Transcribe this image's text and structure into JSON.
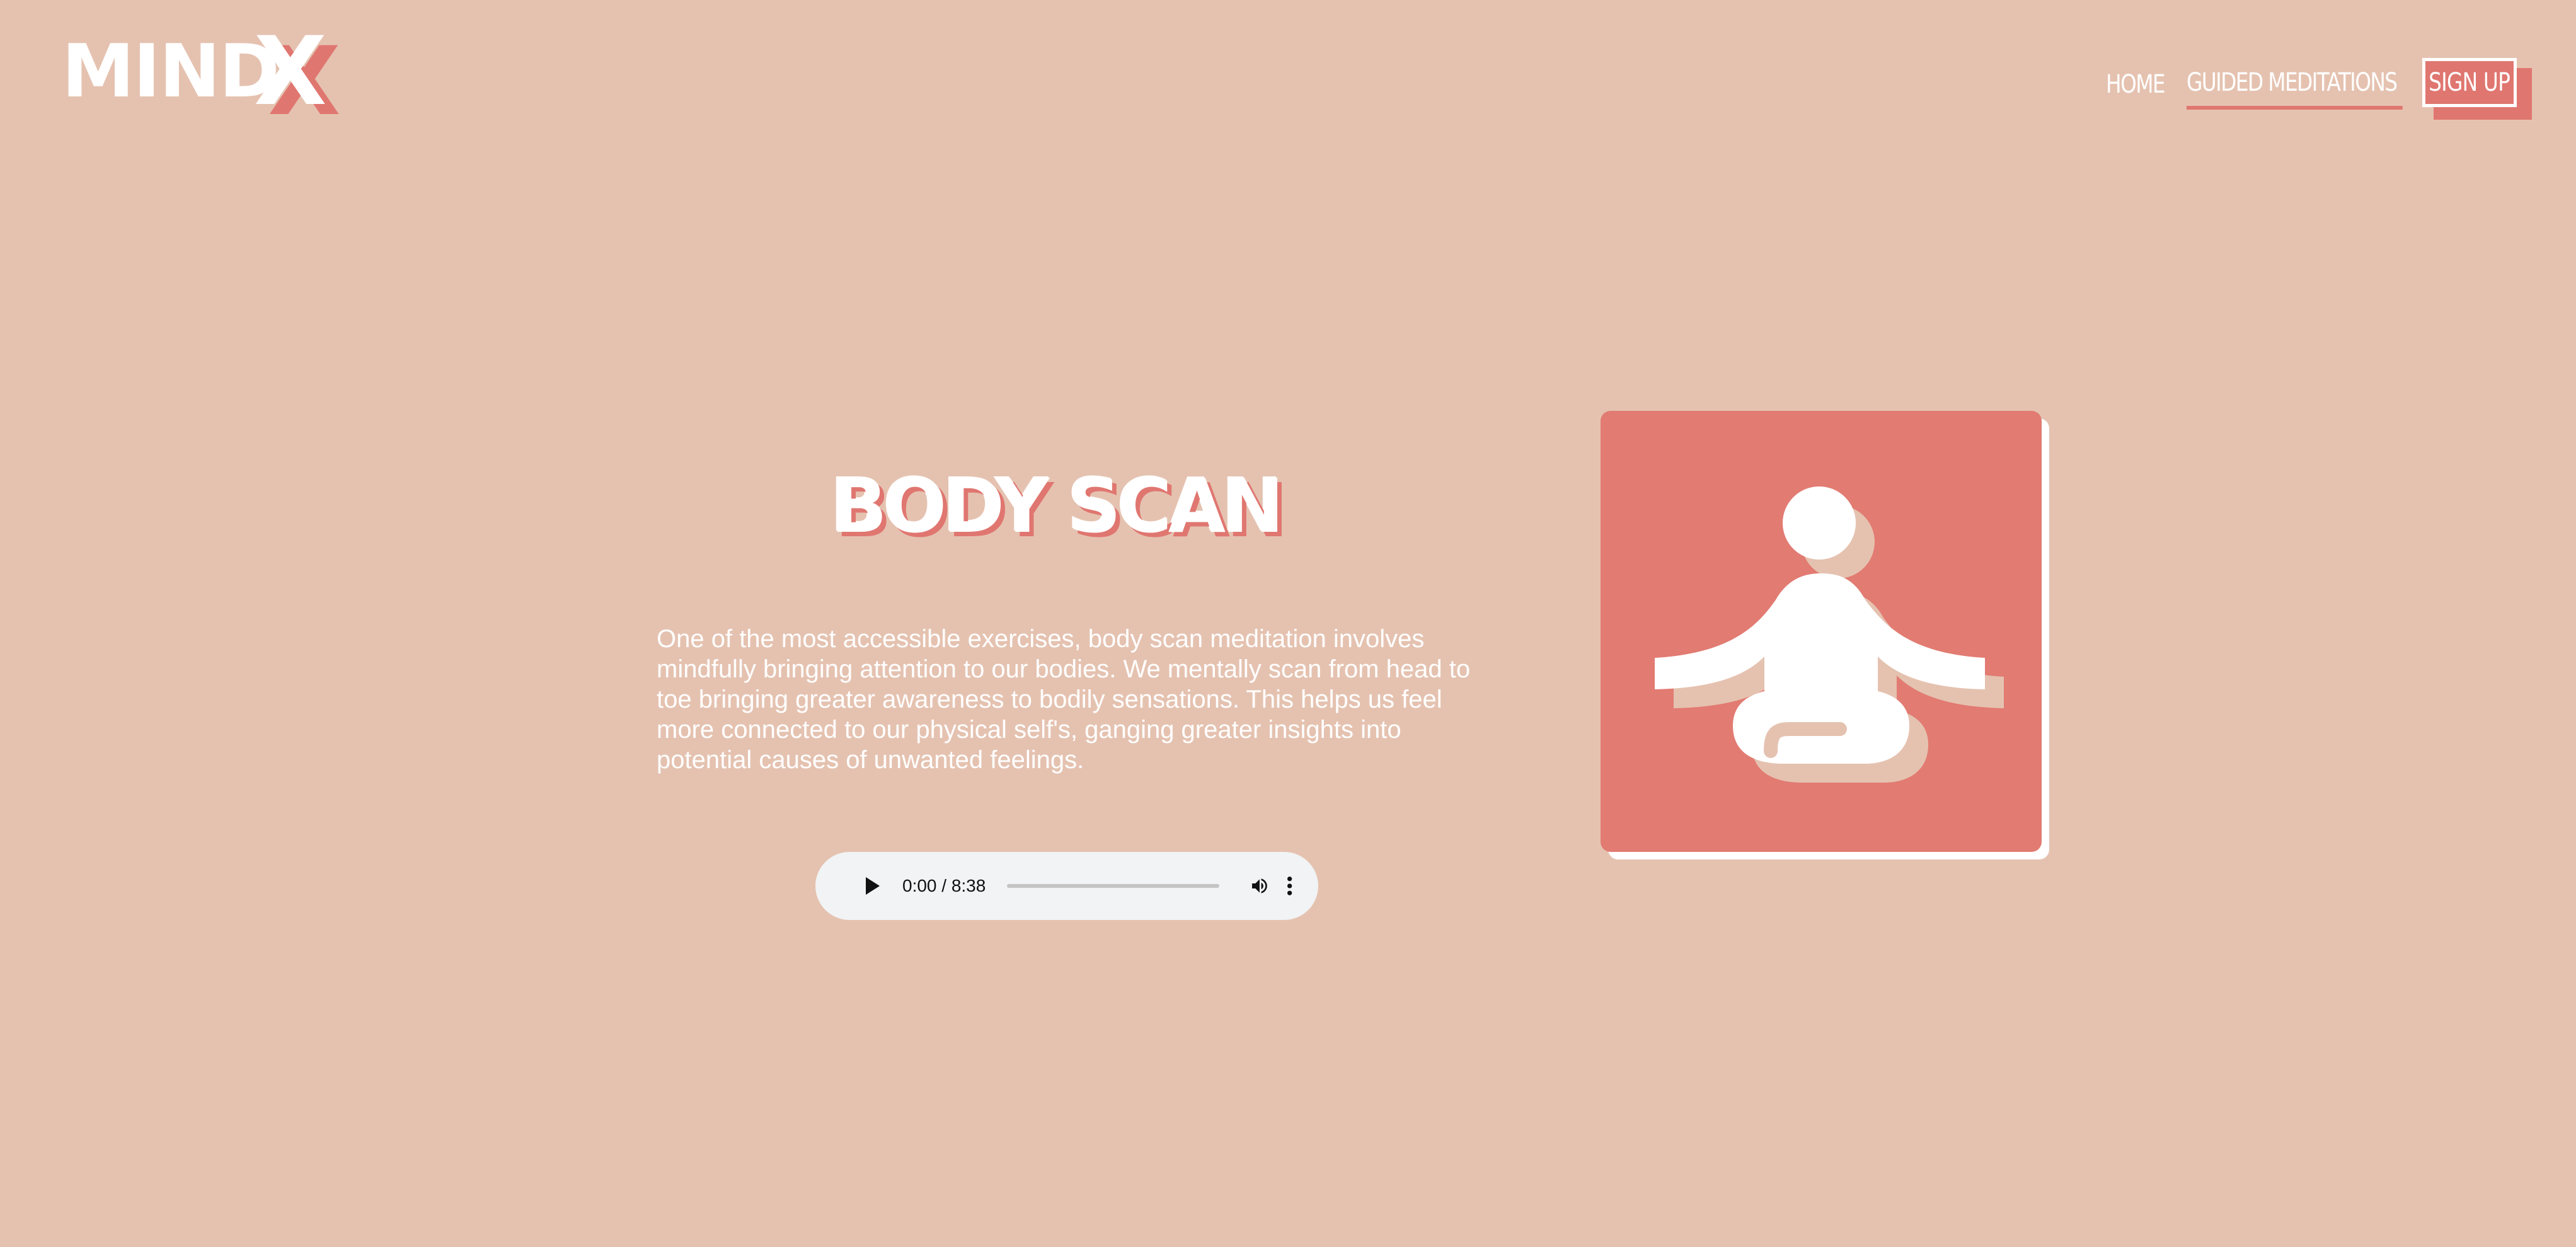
{
  "brand": {
    "logo_main": "MIND",
    "logo_accent": "X"
  },
  "nav": {
    "home": "HOME",
    "guided": "GUIDED MEDITATIONS",
    "signup": "SIGN UP"
  },
  "main": {
    "title": "BODY SCAN",
    "description": "One of the most accessible exercises, body scan meditation involves mindfully bringing attention to our bodies. We mentally scan from head to toe bringing greater awareness to bodily sensations. This helps us feel more connected to our physical self's, ganging greater insights into potential causes of unwanted feelings."
  },
  "audio": {
    "time": "0:00 / 8:38",
    "progress": 0
  },
  "illustration": {
    "icon": "meditation-figure-icon"
  },
  "colors": {
    "background": "#e5c2b0",
    "accent": "#e07670",
    "card": "#e27b72",
    "text": "#ffffff",
    "player": "#f1f3f4"
  }
}
